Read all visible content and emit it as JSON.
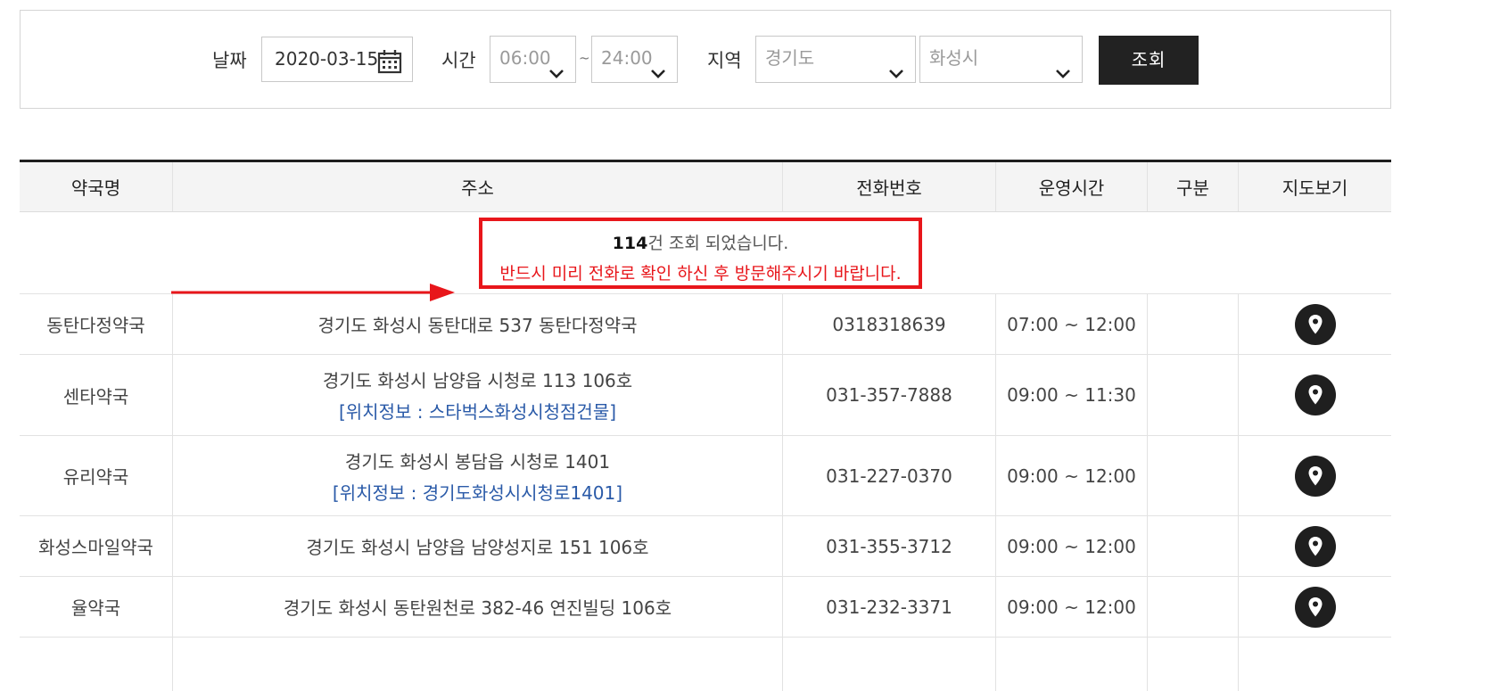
{
  "search": {
    "date_label": "날짜",
    "date_value": "2020-03-15",
    "time_label": "시간",
    "time_start": "06:00",
    "time_sep": "~",
    "time_end": "24:00",
    "region_label": "지역",
    "province": "경기도",
    "city": "화성시",
    "submit_label": "조회"
  },
  "table": {
    "headers": [
      "약국명",
      "주소",
      "전화번호",
      "운영시간",
      "구분",
      "지도보기"
    ],
    "notice": {
      "count": "114",
      "count_suffix": "건 조회 되었습니다.",
      "warning": "반드시 미리 전화로 확인 하신 후 방문해주시기 바랍니다."
    },
    "rows": [
      {
        "name": "동탄다정약국",
        "address": "경기도 화성시 동탄대로 537 동탄다정약국",
        "location": "",
        "phone": "0318318639",
        "hours": "07:00 ~ 12:00",
        "category": ""
      },
      {
        "name": "센타약국",
        "address": "경기도 화성시 남양읍 시청로 113 106호",
        "location": "[위치정보 : 스타벅스화성시청점건물]",
        "phone": "031-357-7888",
        "hours": "09:00 ~ 11:30",
        "category": ""
      },
      {
        "name": "유리약국",
        "address": "경기도 화성시 봉담읍 시청로 1401",
        "location": "[위치정보 : 경기도화성시시청로1401]",
        "phone": "031-227-0370",
        "hours": "09:00 ~ 12:00",
        "category": ""
      },
      {
        "name": "화성스마일약국",
        "address": "경기도 화성시 남양읍 남양성지로 151 106호",
        "location": "",
        "phone": "031-355-3712",
        "hours": "09:00 ~ 12:00",
        "category": ""
      },
      {
        "name": "율약국",
        "address": "경기도 화성시 동탄원천로 382-46 연진빌딩 106호",
        "location": "",
        "phone": "031-232-3371",
        "hours": "09:00 ~ 12:00",
        "category": ""
      }
    ]
  },
  "colors": {
    "accent_red": "#e8161b",
    "link_blue": "#2a5aa8",
    "button_dark": "#222222"
  }
}
